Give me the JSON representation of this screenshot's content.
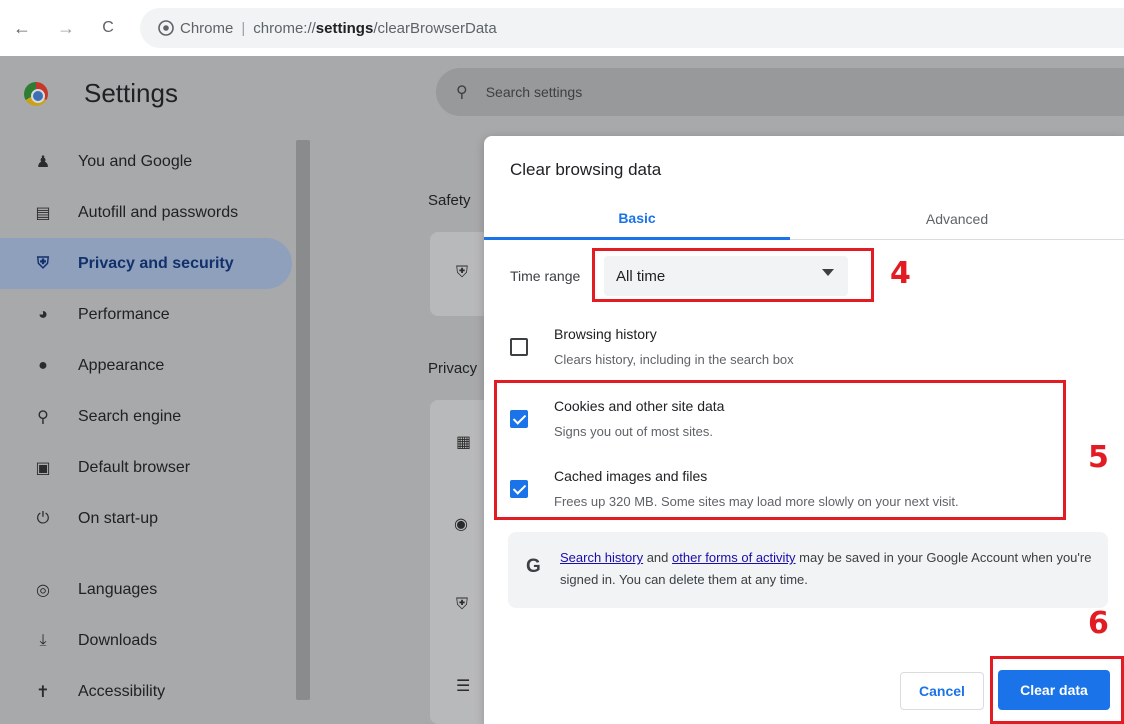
{
  "browser": {
    "back_icon": "←",
    "forward_icon": "→",
    "reload_icon": "C",
    "chip_label": "Chrome",
    "url_prefix": "chrome://",
    "url_bold": "settings",
    "url_suffix": "/clearBrowserData"
  },
  "settings": {
    "title": "Settings",
    "search_placeholder": "Search settings",
    "sidebar": [
      {
        "label": "You and Google",
        "icon": "person-icon"
      },
      {
        "label": "Autofill and passwords",
        "icon": "clipboard-icon"
      },
      {
        "label": "Privacy and security",
        "icon": "shield-icon",
        "active": true
      },
      {
        "label": "Performance",
        "icon": "gauge-icon"
      },
      {
        "label": "Appearance",
        "icon": "palette-icon"
      },
      {
        "label": "Search engine",
        "icon": "search-icon"
      },
      {
        "label": "Default browser",
        "icon": "browser-icon"
      },
      {
        "label": "On start-up",
        "icon": "power-icon"
      },
      {
        "label": "Languages",
        "icon": "globe-icon"
      },
      {
        "label": "Downloads",
        "icon": "download-icon"
      },
      {
        "label": "Accessibility",
        "icon": "accessibility-icon"
      }
    ],
    "bg_safety_label": "Safety",
    "bg_privacy_label": "Privacy"
  },
  "dialog": {
    "title": "Clear browsing data",
    "tabs": [
      {
        "label": "Basic",
        "selected": true
      },
      {
        "label": "Advanced",
        "selected": false
      }
    ],
    "time_range_label": "Time range",
    "time_range_value": "All time",
    "options": [
      {
        "title": "Browsing history",
        "desc": "Clears history, including in the search box",
        "checked": false
      },
      {
        "title": "Cookies and other site data",
        "desc": "Signs you out of most sites.",
        "checked": true
      },
      {
        "title": "Cached images and files",
        "desc": "Frees up 320 MB. Some sites may load more slowly on your next visit.",
        "checked": true
      }
    ],
    "google_notice": {
      "link1": "Search history",
      "text1": " and ",
      "link2": "other forms of activity",
      "text2": " may be saved in your Google Account when you're signed in. You can delete them at any time."
    },
    "cancel_label": "Cancel",
    "clear_label": "Clear data"
  },
  "annotations": [
    "4",
    "5",
    "6"
  ],
  "colors": {
    "accent": "#1a73e8",
    "annotation": "#e31b23"
  }
}
